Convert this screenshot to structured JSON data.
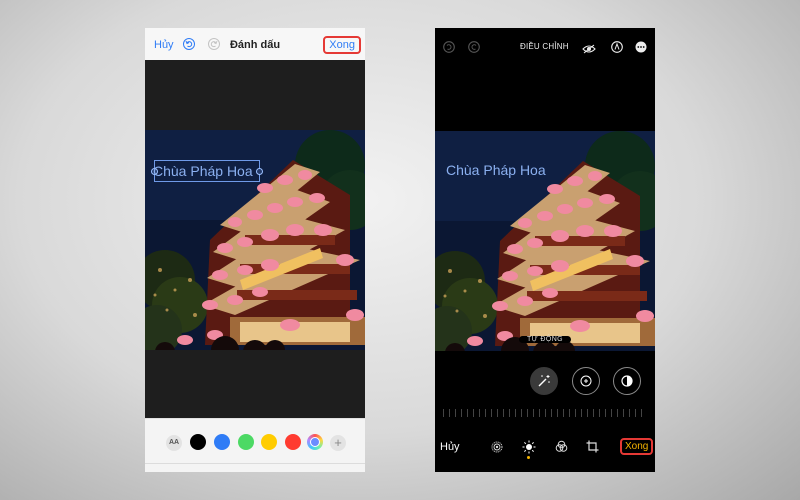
{
  "markup_screen": {
    "header": {
      "cancel_label": "Hủy",
      "title": "Đánh dấu",
      "done_label": "Xong",
      "undo_icon": "undo-icon",
      "redo_icon": "redo-icon"
    },
    "photo_text": "Chùa Pháp Hoa",
    "toolbar": {
      "text_style_label": "AA",
      "colors": [
        "#000000",
        "#2f7cf6",
        "#4cd964",
        "#ffcc00",
        "#ff3b30"
      ],
      "color_picker_icon": "color-wheel-icon",
      "add_icon": "plus-icon"
    }
  },
  "adjust_screen": {
    "header": {
      "title": "ĐIỀU CHỈNH",
      "icons": [
        "undo-icon",
        "redo-icon",
        "eye-icon",
        "markup-pen-icon",
        "more-icon"
      ]
    },
    "photo_text": "Chùa Pháp Hoa",
    "auto_label": "TỰ ĐỘNG",
    "tools": [
      "magic-wand-icon",
      "exposure-icon",
      "contrast-icon"
    ],
    "bottom_bar": {
      "cancel_label": "Hủy",
      "done_label": "Xong",
      "tabs": [
        "live-photo-icon",
        "adjust-icon",
        "filters-icon",
        "crop-icon"
      ],
      "active_tab": "adjust-icon"
    }
  },
  "colors": {
    "ios_blue": "#2f7cf6",
    "accent_yellow": "#f5b400",
    "highlight_red": "#e53935"
  }
}
